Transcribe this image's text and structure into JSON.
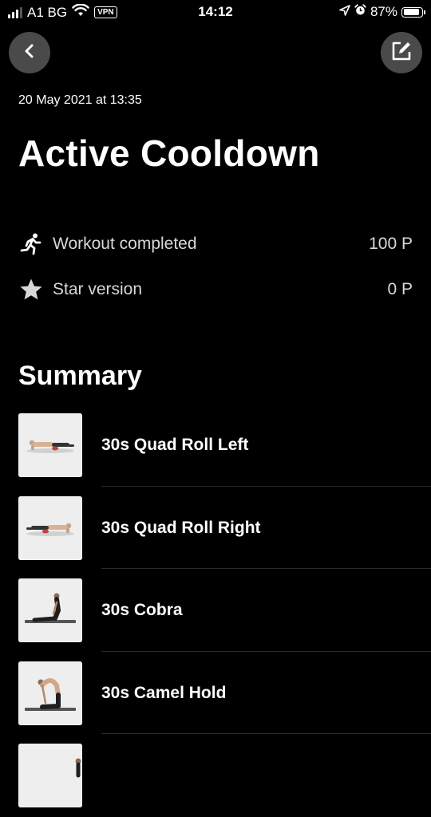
{
  "status_bar": {
    "carrier": "A1 BG",
    "vpn": "VPN",
    "time": "14:12",
    "battery": "87%",
    "battery_level": 0.87
  },
  "header": {
    "date": "20 May 2021 at 13:35",
    "title": "Active Cooldown"
  },
  "points": [
    {
      "icon": "running-person-icon",
      "label": "Workout completed",
      "value": "100 P"
    },
    {
      "icon": "star-icon",
      "label": "Star version",
      "value": "0 P"
    }
  ],
  "summary": {
    "title": "Summary",
    "exercises": [
      {
        "name": "30s Quad Roll Left"
      },
      {
        "name": "30s Quad Roll Right"
      },
      {
        "name": "30s Cobra"
      },
      {
        "name": "30s Camel Hold"
      }
    ]
  },
  "colors": {
    "background": "#000000",
    "button_bg": "#4a4a4a",
    "text": "#ffffff",
    "muted_text": "#d8d8d8"
  }
}
